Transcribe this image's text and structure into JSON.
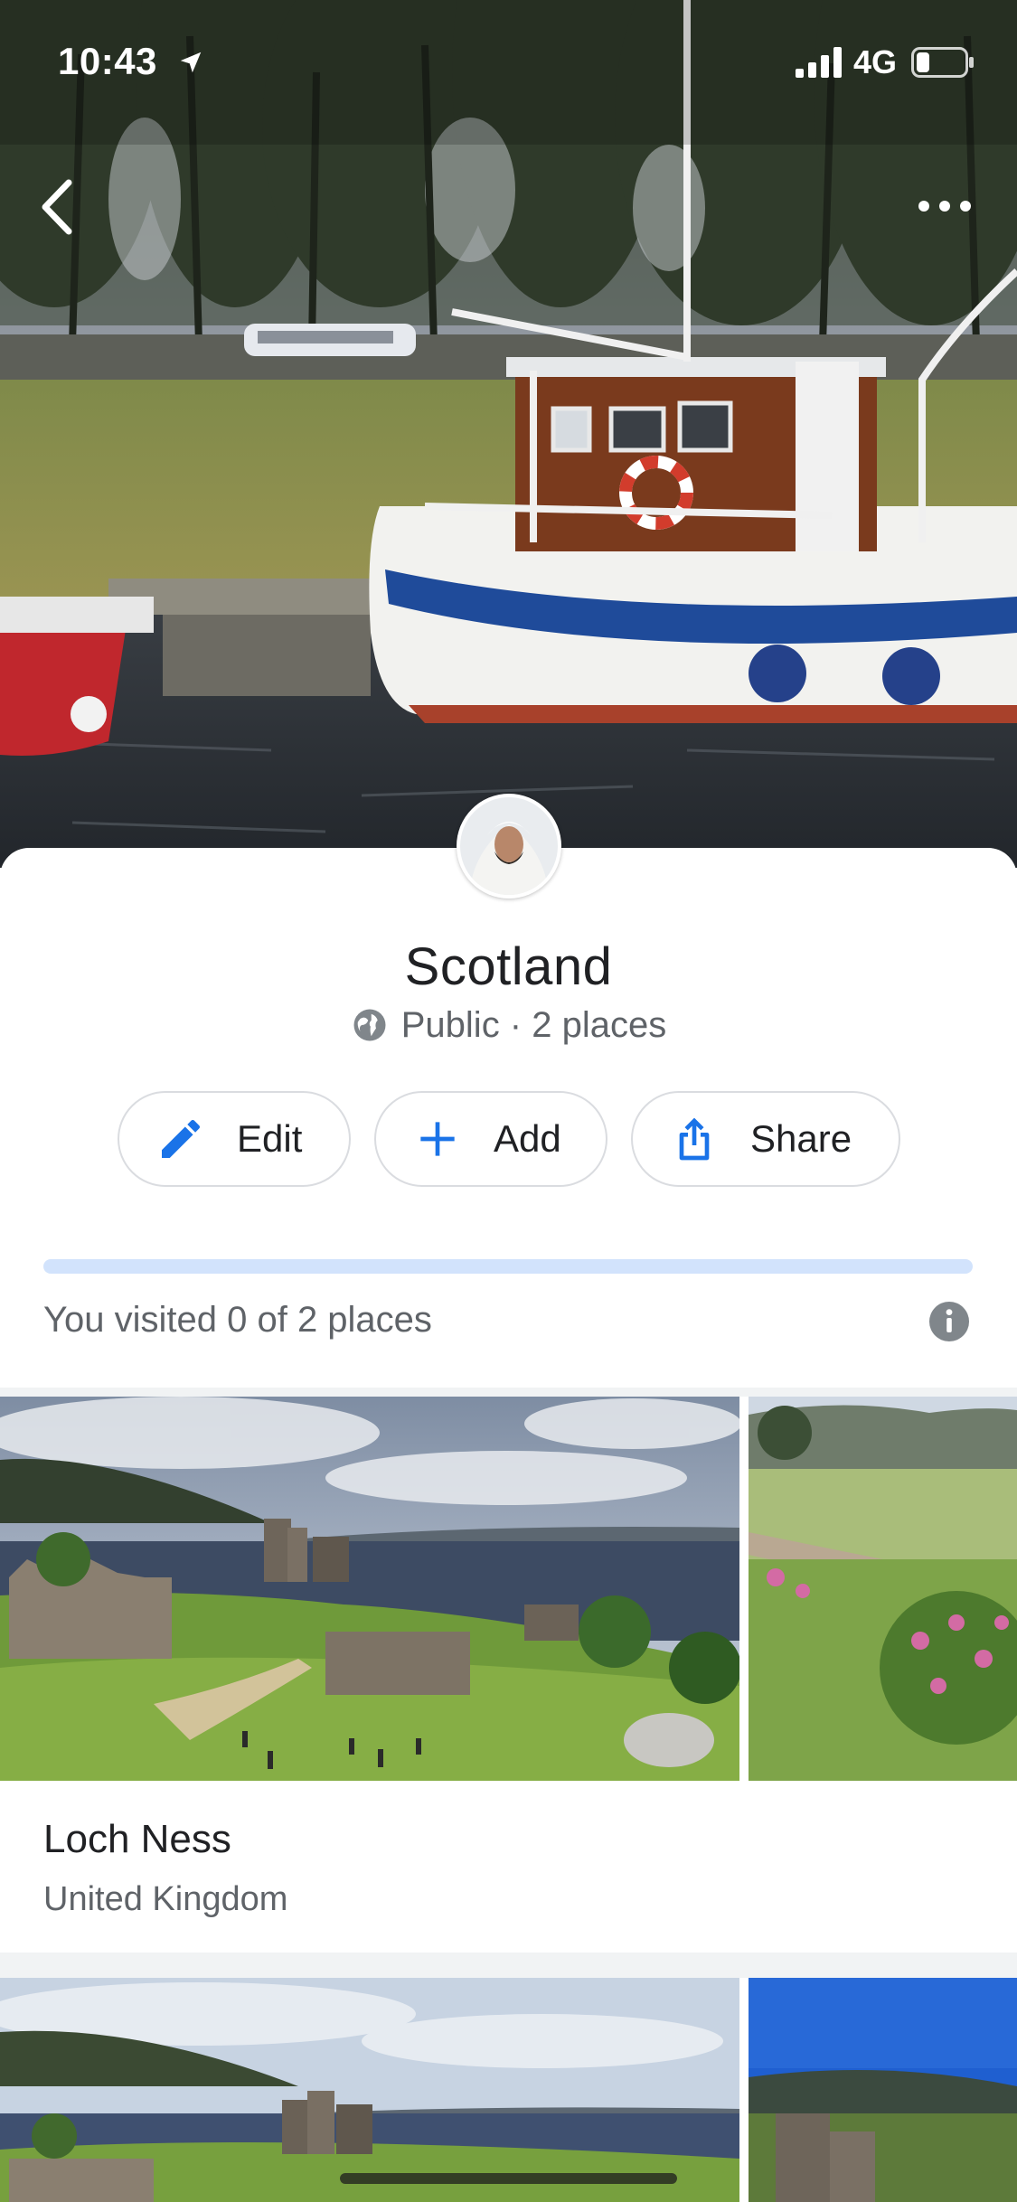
{
  "status_bar": {
    "time": "10:43",
    "network": "4G",
    "icons": [
      "location-arrow-icon",
      "signal-bars-icon",
      "battery-icon"
    ]
  },
  "nav": {
    "icons": [
      "back-chevron-icon",
      "more-options-icon"
    ]
  },
  "list": {
    "title": "Scotland",
    "meta": "Public · 2 places",
    "meta_icon": "globe-icon"
  },
  "actions": [
    {
      "label": "Edit",
      "icon": "pencil-icon"
    },
    {
      "label": "Add",
      "icon": "plus-icon"
    },
    {
      "label": "Share",
      "icon": "share-icon"
    }
  ],
  "progress": {
    "visited_text": "You visited 0 of 2 places",
    "fraction": 0.0
  },
  "places": [
    {
      "name": "Loch Ness",
      "subtitle": "United Kingdom"
    }
  ],
  "colors": {
    "accent": "#1a73e8",
    "progress_track": "#d2e3fc",
    "text_primary": "#202124",
    "text_secondary": "#5f6368"
  }
}
